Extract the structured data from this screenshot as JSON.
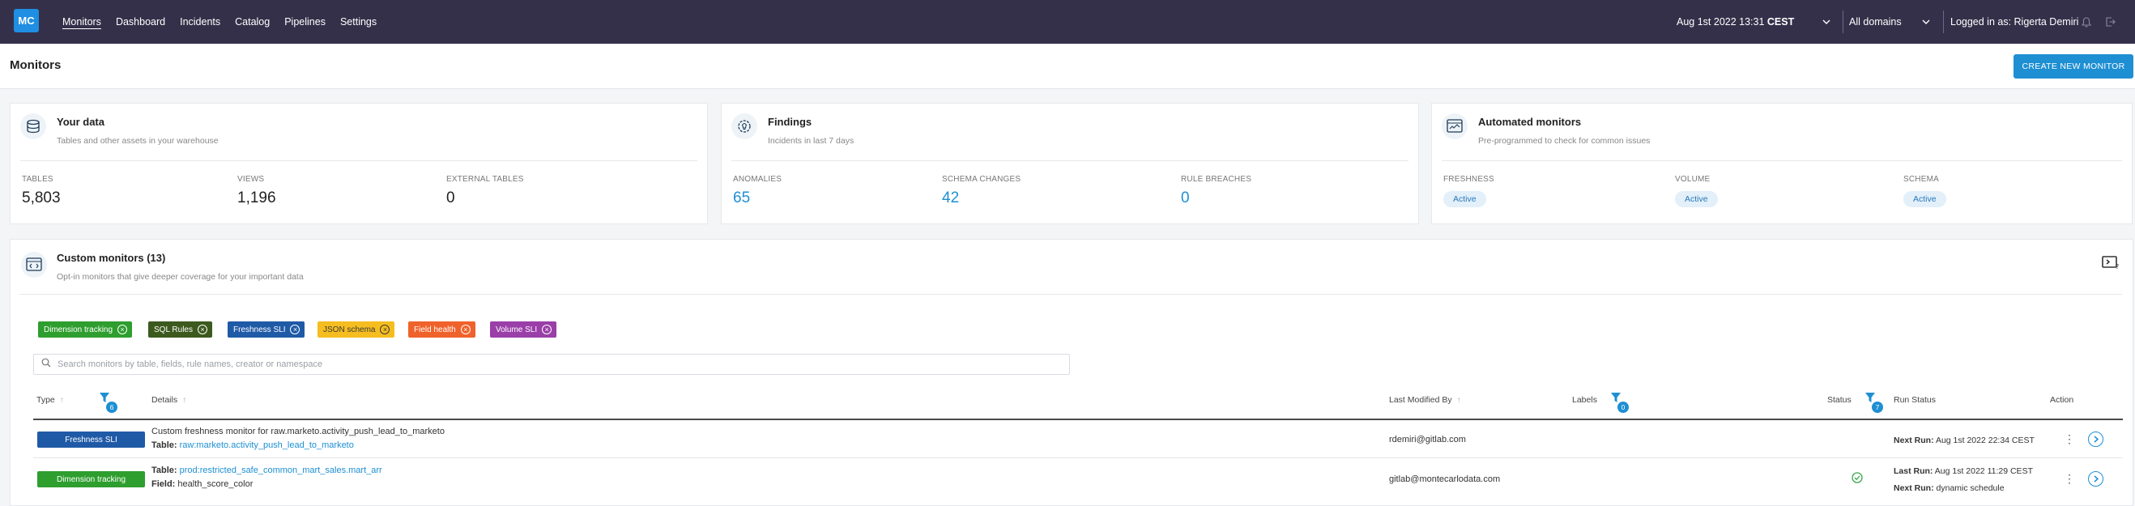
{
  "nav": {
    "logo": "MC",
    "links": [
      "Monitors",
      "Dashboard",
      "Incidents",
      "Catalog",
      "Pipelines",
      "Settings"
    ],
    "date_prefix": "Aug 1st 2022 13:31 ",
    "date_tz": "CEST",
    "domain": "All domains",
    "logged_in": "Logged in as: Rigerta Demiri"
  },
  "page": {
    "title": "Monitors",
    "create_button": "CREATE NEW MONITOR"
  },
  "cards": {
    "your_data": {
      "title": "Your data",
      "subtitle": "Tables and other assets in your warehouse",
      "stats": [
        {
          "label": "TABLES",
          "value": "5,803"
        },
        {
          "label": "VIEWS",
          "value": "1,196"
        },
        {
          "label": "EXTERNAL TABLES",
          "value": "0"
        }
      ]
    },
    "findings": {
      "title": "Findings",
      "subtitle": "Incidents in last 7 days",
      "stats": [
        {
          "label": "ANOMALIES",
          "value": "65"
        },
        {
          "label": "SCHEMA CHANGES",
          "value": "42"
        },
        {
          "label": "RULE BREACHES",
          "value": "0"
        }
      ]
    },
    "automated": {
      "title": "Automated monitors",
      "subtitle": "Pre-programmed to check for common issues",
      "stats": [
        {
          "label": "FRESHNESS",
          "value": "Active"
        },
        {
          "label": "VOLUME",
          "value": "Active"
        },
        {
          "label": "SCHEMA",
          "value": "Active"
        }
      ]
    }
  },
  "custom": {
    "title": "Custom monitors (13)",
    "subtitle": "Opt-in monitors that give deeper coverage for your important data",
    "chips": [
      {
        "label": "Dimension tracking",
        "color": "#2e9e2e"
      },
      {
        "label": "SQL Rules",
        "color": "#3c5a1e"
      },
      {
        "label": "Freshness SLI",
        "color": "#1f5aa6"
      },
      {
        "label": "JSON schema",
        "color": "#f5bd1f"
      },
      {
        "label": "Field health",
        "color": "#f0622b"
      },
      {
        "label": "Volume SLI",
        "color": "#9a3ea8"
      }
    ],
    "search_placeholder": "Search monitors by table, fields, rule names, creator or namespace",
    "columns": {
      "type": "Type",
      "type_filter_count": "6",
      "details": "Details",
      "last_modified": "Last Modified By",
      "labels": "Labels",
      "labels_filter_count": "0",
      "status": "Status",
      "status_filter_count": "7",
      "run_status": "Run Status",
      "action": "Action"
    },
    "rows": [
      {
        "type": "Freshness SLI",
        "type_color": "#1f5aa6",
        "details_line1": "Custom freshness monitor for raw.marketo.activity_push_lead_to_marketo",
        "details_line2_label": "Table:",
        "details_line2_value": "raw:marketo.activity_push_lead_to_marketo",
        "modified_by": "rdemiri@gitlab.com",
        "status": "",
        "next_run_label": "Next Run:",
        "next_run_value": "Aug 1st 2022 22:34 CEST"
      },
      {
        "type": "Dimension tracking",
        "type_color": "#2e9e2e",
        "details_line1_label": "Table:",
        "details_line1_value": "prod:restricted_safe_common_mart_sales.mart_arr",
        "details_line2_label": "Field:",
        "details_line2_value": "health_score_color",
        "modified_by": "gitlab@montecarlodata.com",
        "status": "check-circle",
        "last_run_label": "Last Run:",
        "last_run_value": "Aug 1st 2022 11:29 CEST",
        "next_run_label": "Next Run:",
        "next_run_value": "dynamic schedule"
      }
    ]
  }
}
